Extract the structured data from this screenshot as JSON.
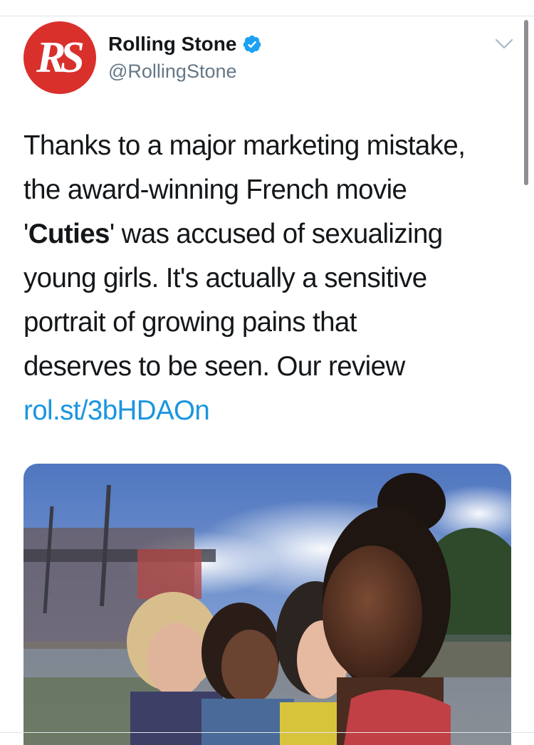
{
  "account": {
    "display_name": "Rolling Stone",
    "handle": "@RollingStone",
    "avatar_text": "RS",
    "verified": true
  },
  "tweet": {
    "text_line1": "Thanks to a major marketing mistake,",
    "text_line2": "the award-winning French movie",
    "quote_open": "'",
    "bold_word": "Cuties",
    "text_line3_rest": "' was accused of sexualizing",
    "text_line4": "young girls. It's actually a sensitive",
    "text_line5": "portrait of growing pains that",
    "text_line6": "deserves to be seen. Our review",
    "link": "rol.st/3bHDAOn"
  },
  "colors": {
    "brand_red": "#d9302c",
    "link_blue": "#1b95e0",
    "verified_blue": "#1da1f2",
    "text": "#14171a",
    "secondary_text": "#657786"
  },
  "icons": {
    "verified": "verified-badge-icon",
    "menu": "chevron-down-icon"
  }
}
